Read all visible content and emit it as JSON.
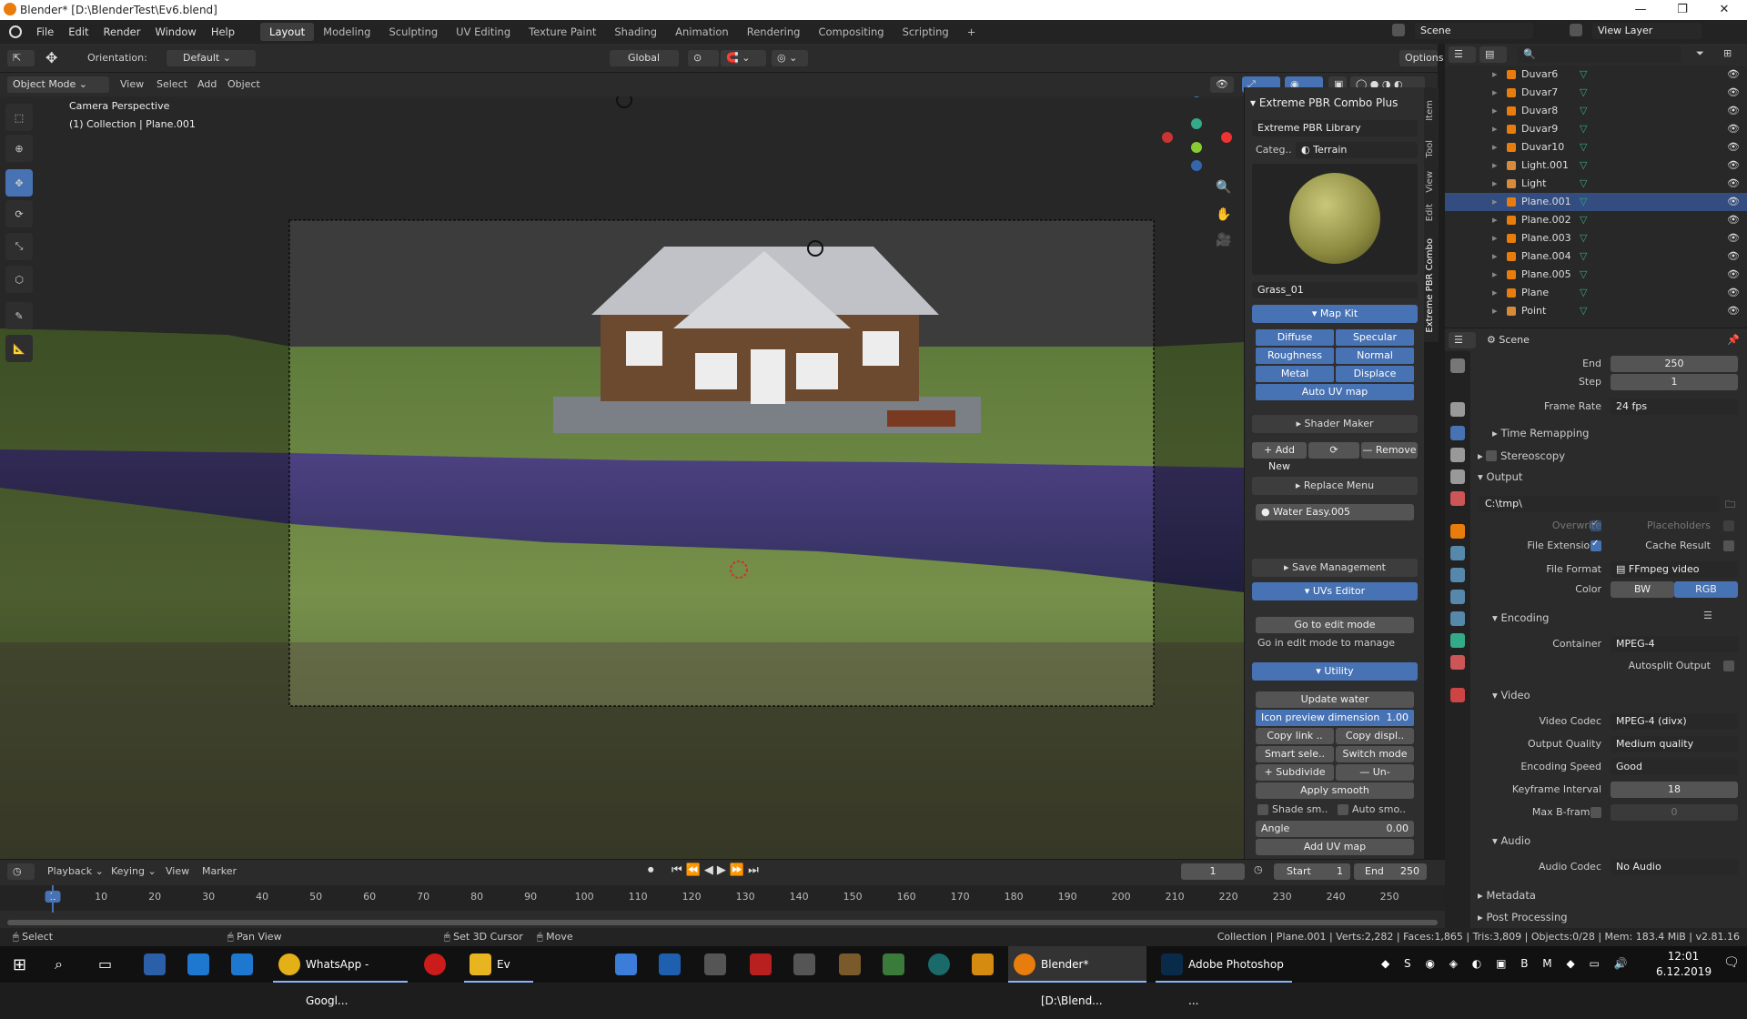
{
  "window": {
    "title": "Blender* [D:\\BlenderTest\\Ev6.blend]",
    "minimize": "—",
    "maximize": "❐",
    "close": "✕"
  },
  "menu": {
    "items": [
      "File",
      "Edit",
      "Render",
      "Window",
      "Help"
    ],
    "workspaces": [
      "Layout",
      "Modeling",
      "Sculpting",
      "UV Editing",
      "Texture Paint",
      "Shading",
      "Animation",
      "Rendering",
      "Compositing",
      "Scripting",
      "+"
    ],
    "scene": "Scene",
    "view_layer": "View Layer"
  },
  "toolhdr": {
    "orientation_label": "Orientation:",
    "orientation_value": "Default",
    "transform": "Global",
    "options": "Options"
  },
  "vphdr": {
    "mode": "Object Mode",
    "items": [
      "View",
      "Select",
      "Add",
      "Object"
    ]
  },
  "viewport": {
    "info_line1": "Camera Perspective",
    "info_line2": "(1) Collection | Plane.001"
  },
  "npanel": {
    "header": "Extreme PBR Combo Plus",
    "library": "Extreme PBR Library",
    "category_label": "Categ..",
    "category_value": "Terrain",
    "material_name": "Grass_01",
    "map_kit": "Map Kit",
    "maps": [
      "Diffuse",
      "Specular",
      "Roughness",
      "Normal",
      "Metal",
      "Displace"
    ],
    "auto_uv": "Auto UV map",
    "shader_maker": "Shader Maker",
    "add_new": "+ Add New",
    "remove": "— Remove",
    "replace_menu": "Replace Menu",
    "water_slot": "Water Easy.005",
    "save_management": "Save Management",
    "uvs_editor": "UVs Editor",
    "go_edit": "Go to edit mode",
    "go_edit_hint": "Go in edit mode to manage",
    "utility": "Utility",
    "update_water": "Update water",
    "icon_preview_label": "Icon preview dimension",
    "icon_preview_value": "1.00",
    "copy_link": "Copy link ..",
    "copy_displ": "Copy displ..",
    "smart_sele": "Smart sele..",
    "switch_mode": "Switch mode",
    "subdivide": "+ Subdivide",
    "un_subdivide": "— Un-subdivide",
    "apply_smooth": "Apply smooth",
    "shade_sm": "Shade sm..",
    "auto_smo": "Auto smo..",
    "angle_label": "Angle",
    "angle_value": "0.00",
    "add_uv_map": "Add UV map"
  },
  "npanel_tabs": [
    "Item",
    "Tool",
    "View",
    "Edit",
    "Extreme PBR Combo"
  ],
  "outliner": {
    "rows": [
      "Duvar6",
      "Duvar7",
      "Duvar8",
      "Duvar9",
      "Duvar10",
      "Light.001",
      "Light",
      "Plane.001",
      "Plane.002",
      "Plane.003",
      "Plane.004",
      "Plane.005",
      "Plane",
      "Point"
    ],
    "selected_index": 7
  },
  "props": {
    "context": "Scene",
    "end_label": "End",
    "end_value": "250",
    "step_label": "Step",
    "step_value": "1",
    "framerate_label": "Frame Rate",
    "framerate_value": "24 fps",
    "time_remapping": "Time Remapping",
    "stereoscopy": "Stereoscopy",
    "output": "Output",
    "output_path": "C:\\tmp\\",
    "overwrite": "Overwrite",
    "placeholders": "Placeholders",
    "file_extensions": "File Extensions",
    "cache_result": "Cache Result",
    "file_format_label": "File Format",
    "file_format_value": "FFmpeg video",
    "color_label": "Color",
    "color_bw": "BW",
    "color_rgb": "RGB",
    "encoding": "Encoding",
    "container_label": "Container",
    "container_value": "MPEG-4",
    "autosplit": "Autosplit Output",
    "video": "Video",
    "video_codec_label": "Video Codec",
    "video_codec_value": "MPEG-4 (divx)",
    "output_quality_label": "Output Quality",
    "output_quality_value": "Medium quality",
    "encoding_speed_label": "Encoding Speed",
    "encoding_speed_value": "Good",
    "keyframe_label": "Keyframe Interval",
    "keyframe_value": "18",
    "bframes_label": "Max B-frames",
    "bframes_value": "0",
    "audio": "Audio",
    "audio_codec_label": "Audio Codec",
    "audio_codec_value": "No Audio",
    "metadata": "Metadata",
    "post_processing": "Post Processing"
  },
  "timeline": {
    "menus": [
      "Playback",
      "Keying",
      "View",
      "Marker"
    ],
    "current_frame": "1",
    "start_label": "Start",
    "start_value": "1",
    "end_label": "End",
    "end_value": "250",
    "ticks": [
      "1",
      "10",
      "20",
      "30",
      "40",
      "50",
      "60",
      "70",
      "80",
      "90",
      "100",
      "110",
      "120",
      "130",
      "140",
      "150",
      "160",
      "170",
      "180",
      "190",
      "200",
      "210",
      "220",
      "230",
      "240",
      "250"
    ]
  },
  "statusbar": {
    "select": "Select",
    "pan_view": "Pan View",
    "set_cursor": "Set 3D Cursor",
    "move": "Move",
    "stats": "Collection | Plane.001 | Verts:2,282 | Faces:1,865 | Tris:3,809 | Objects:0/28 | Mem: 183.4 MiB | v2.81.16"
  },
  "taskbar": {
    "whatsapp": "WhatsApp - Googl...",
    "explorer": "Ev",
    "blender": "Blender* [D:\\Blend...",
    "photoshop": "Adobe Photoshop ...",
    "time": "12:01",
    "date": "6.12.2019"
  },
  "colors": {
    "accent": "#4772b3",
    "selected_row": "#334d80",
    "orange": "#e87d0d"
  }
}
